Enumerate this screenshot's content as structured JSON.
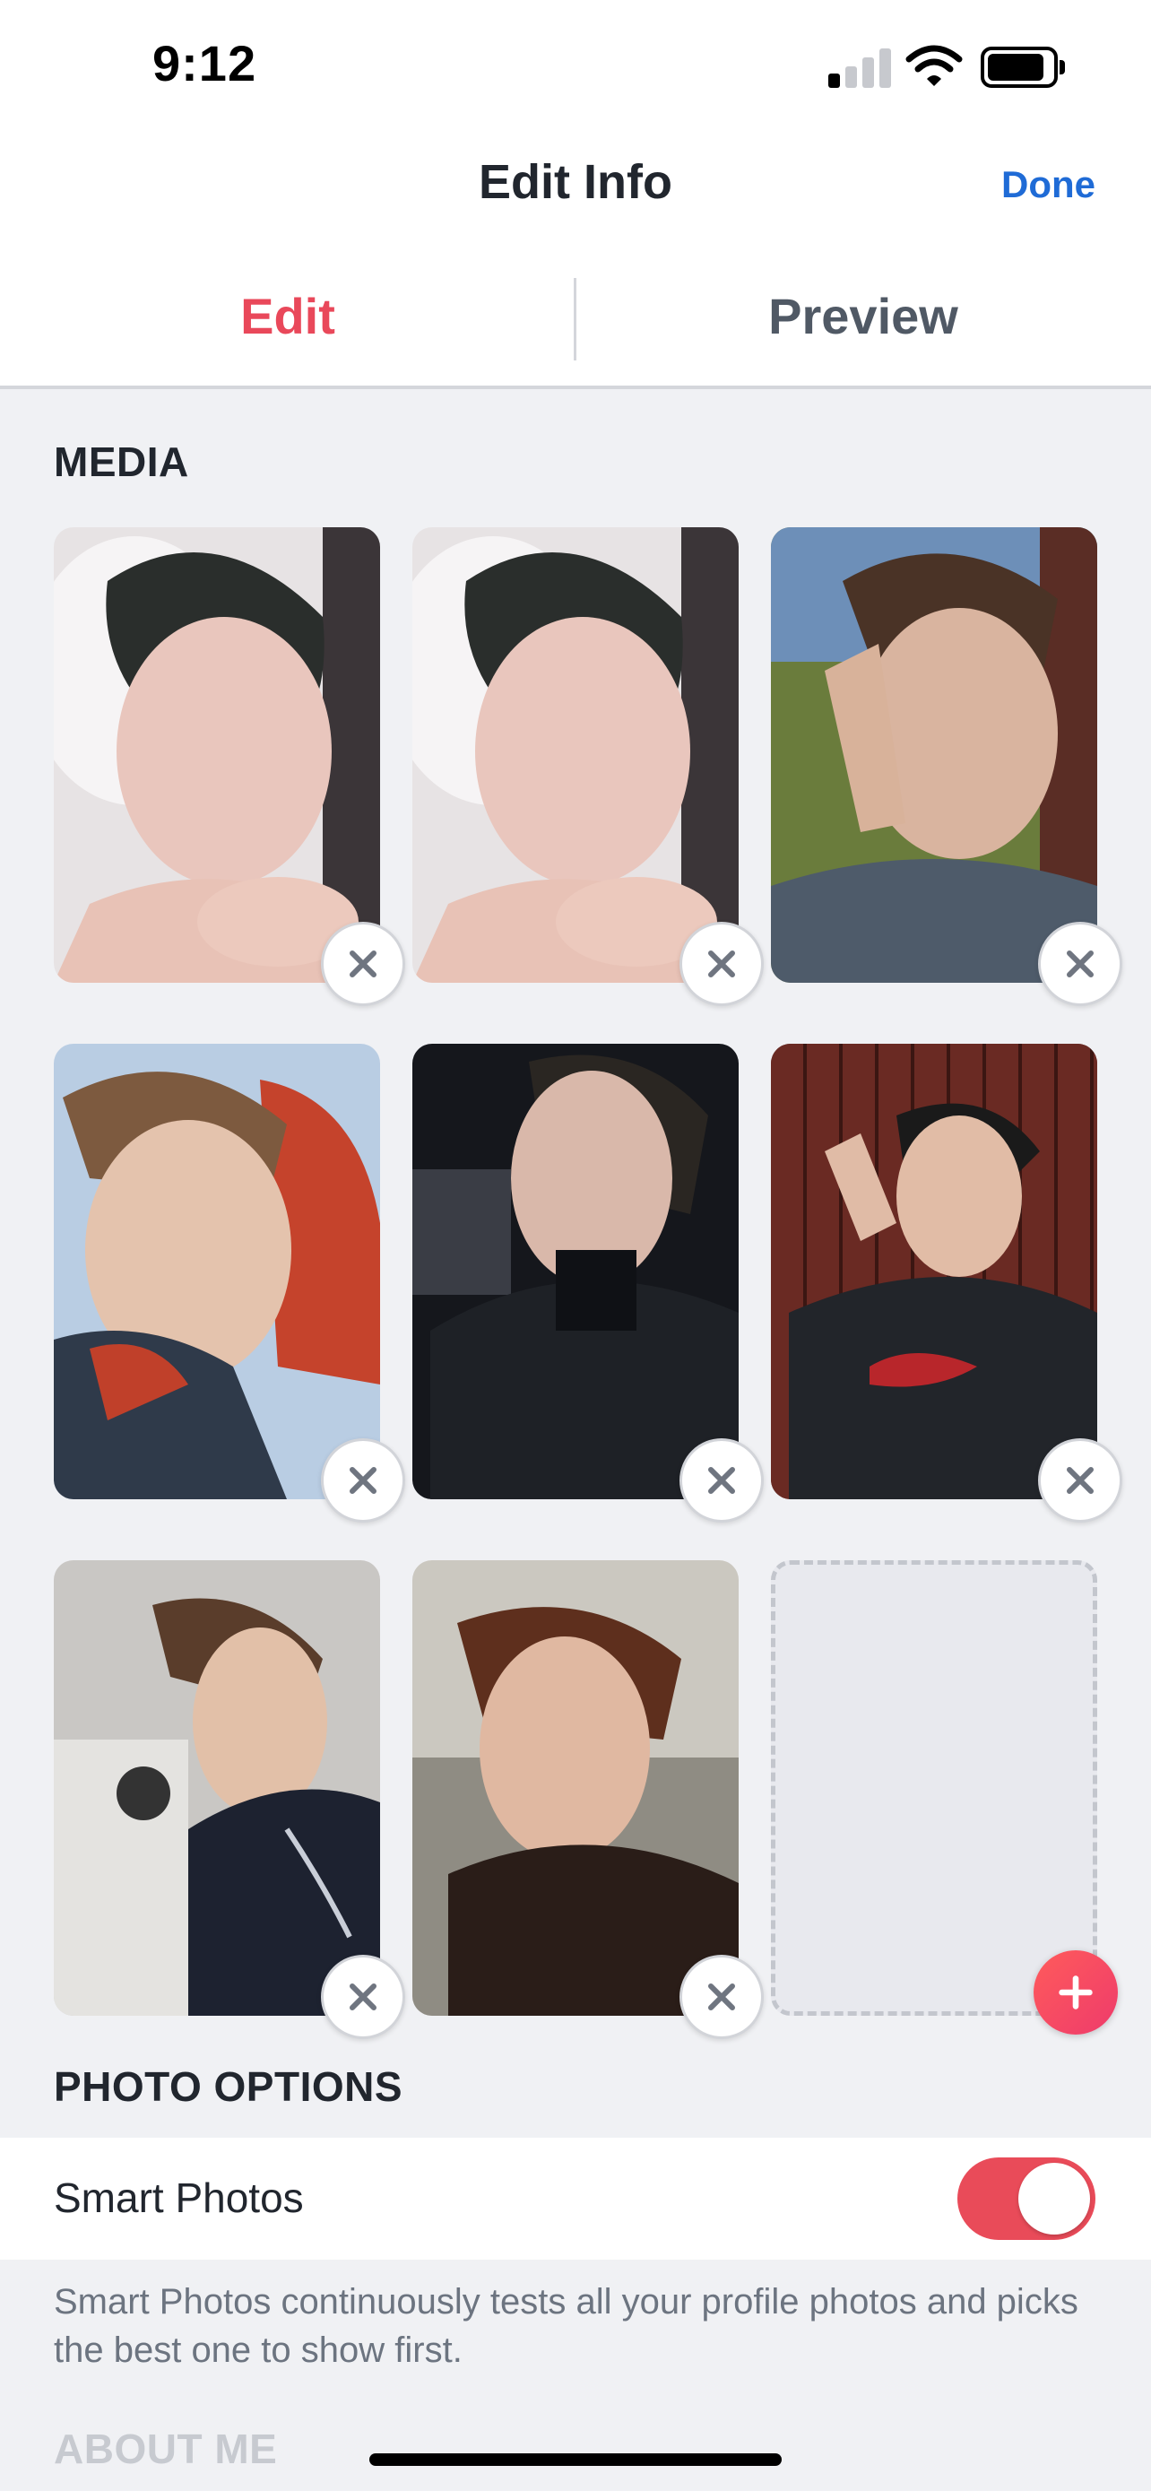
{
  "status_bar": {
    "time": "9:12"
  },
  "nav": {
    "title": "Edit Info",
    "done_label": "Done"
  },
  "tabs": [
    {
      "label": "Edit",
      "active": true
    },
    {
      "label": "Preview",
      "active": false
    }
  ],
  "media": {
    "header": "MEDIA",
    "photos": [
      {
        "filled": true
      },
      {
        "filled": true
      },
      {
        "filled": true
      },
      {
        "filled": true
      },
      {
        "filled": true
      },
      {
        "filled": true
      },
      {
        "filled": true
      },
      {
        "filled": true
      },
      {
        "filled": false
      }
    ]
  },
  "photo_options": {
    "header": "PHOTO OPTIONS",
    "smart_photos_label": "Smart Photos",
    "smart_photos_enabled": true,
    "description": "Smart Photos continuously tests all your profile photos and picks the best one to show first."
  },
  "about_me": {
    "header": "ABOUT ME"
  },
  "colors": {
    "accent_red": "#e9485a",
    "link_blue": "#1f6bd6",
    "background": "#f0f1f4"
  }
}
